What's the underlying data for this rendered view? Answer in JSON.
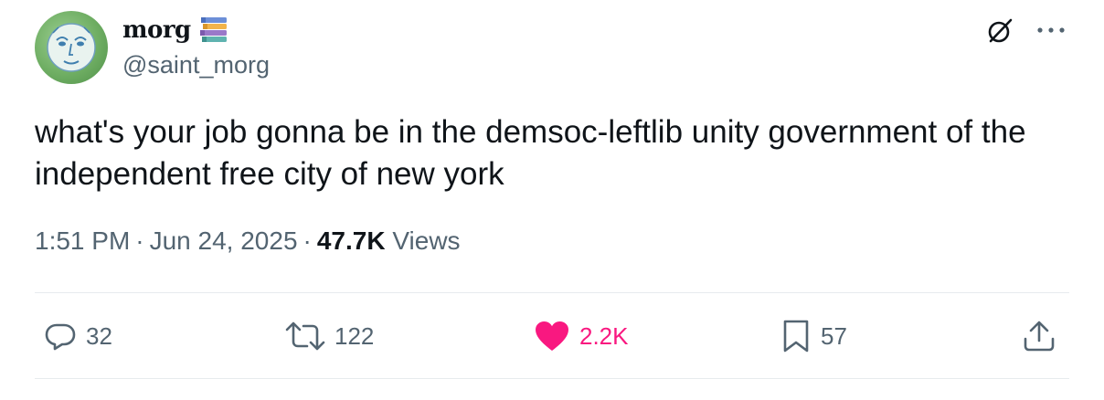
{
  "author": {
    "display_name": "morg",
    "handle": "@saint_morg",
    "avatar_icon": "green-moon-face-avatar",
    "name_emoji_icon": "books-icon"
  },
  "header": {
    "grok_icon": "grok-icon",
    "more_icon": "more-options-icon"
  },
  "tweet": {
    "text": "what's your job gonna be in the demsoc-leftlib unity government of the independent free city of new york"
  },
  "meta": {
    "time": "1:51 PM",
    "separator": "·",
    "date": "Jun 24, 2025",
    "views_count": "47.7K",
    "views_label": "Views"
  },
  "actions": {
    "reply": {
      "icon": "reply-icon",
      "count": "32"
    },
    "retweet": {
      "icon": "retweet-icon",
      "count": "122"
    },
    "like": {
      "icon": "heart-icon",
      "count": "2.2K",
      "active": true,
      "color": "#f91880"
    },
    "bookmark": {
      "icon": "bookmark-icon",
      "count": "57"
    },
    "share": {
      "icon": "share-icon"
    }
  },
  "colors": {
    "text": "#0f1419",
    "secondary": "#536471",
    "like": "#f91880",
    "divider": "#e7ebee"
  }
}
